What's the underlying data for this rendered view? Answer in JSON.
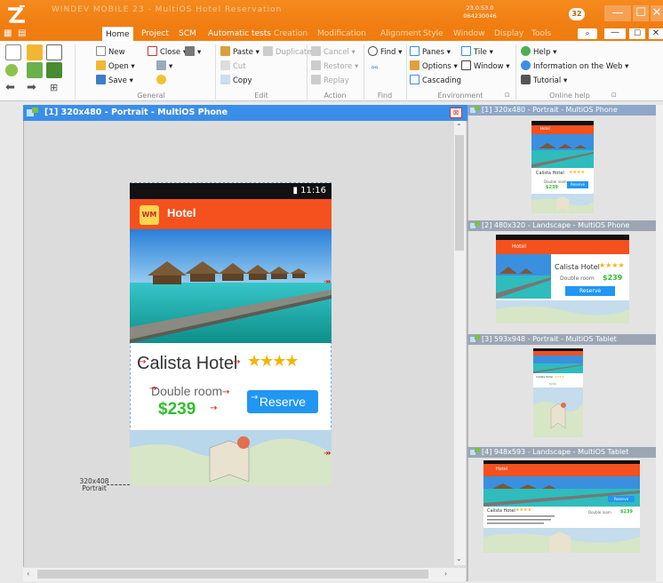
{
  "app": {
    "title_garble": "WINDEV MOBILE 23 - MultiOS Hotel Reservation",
    "version_line1": "23.0.53.0",
    "version_line2": "064230046",
    "user_badge": "32",
    "win_min": "—",
    "win_max": "☐",
    "win_close": "✕"
  },
  "tabs": [
    {
      "label": "Home",
      "active": true
    },
    {
      "label": "Project"
    },
    {
      "label": "SCM"
    },
    {
      "label": "Automatic tests"
    },
    {
      "label": "Creation"
    },
    {
      "label": "Modification"
    },
    {
      "label": "Alignment"
    },
    {
      "label": "Style"
    },
    {
      "label": "Window"
    },
    {
      "label": "Display"
    },
    {
      "label": "Tools"
    }
  ],
  "ribbon": {
    "general": {
      "new": "New",
      "open": "Open",
      "save": "Save",
      "close": "Close",
      "label": "General"
    },
    "edit": {
      "paste": "Paste",
      "duplicate": "Duplicate",
      "cut": "Cut",
      "copy": "Copy",
      "label": "Edit"
    },
    "action": {
      "cancel": "Cancel",
      "restore": "Restore",
      "replay": "Replay",
      "label": "Action"
    },
    "find": {
      "find": "Find",
      "label": "Find"
    },
    "environment": {
      "panes": "Panes",
      "tile": "Tile",
      "options": "Options",
      "window": "Window",
      "cascading": "Cascading",
      "label": "Environment"
    },
    "online_help": {
      "help": "Help",
      "info_web": "Information on the Web",
      "tutorial": "Tutorial",
      "label": "Online help"
    }
  },
  "designer": {
    "header": "[1] 320x480 - Portrait - MultiOS Phone",
    "status_time": "11:16",
    "app_title": "Hotel",
    "app_icon_text": "WM",
    "hotel_name": "Calista Hotel",
    "stars": "★★★★",
    "room_type": "Double room",
    "price": "$239",
    "reserve_label": "Reserve",
    "size_caption_line1": "320x408",
    "size_caption_line2": "Portrait"
  },
  "previews": [
    {
      "label": "[1] 320x480 - Portrait - MultiOS Phone"
    },
    {
      "label": "[2] 480x320 - Landscape - MultiOS Phone"
    },
    {
      "label": "[3] 593x948 - Portrait - MultiOS Tablet"
    },
    {
      "label": "[4] 948x593 - Landscape - MultiOS Tablet"
    }
  ],
  "colors": {
    "brand_orange": "#f07d10",
    "accent_blue": "#3a8ee8",
    "appbar": "#f4511e",
    "price_green": "#2fbf2f",
    "reserve_blue": "#2196f3"
  }
}
